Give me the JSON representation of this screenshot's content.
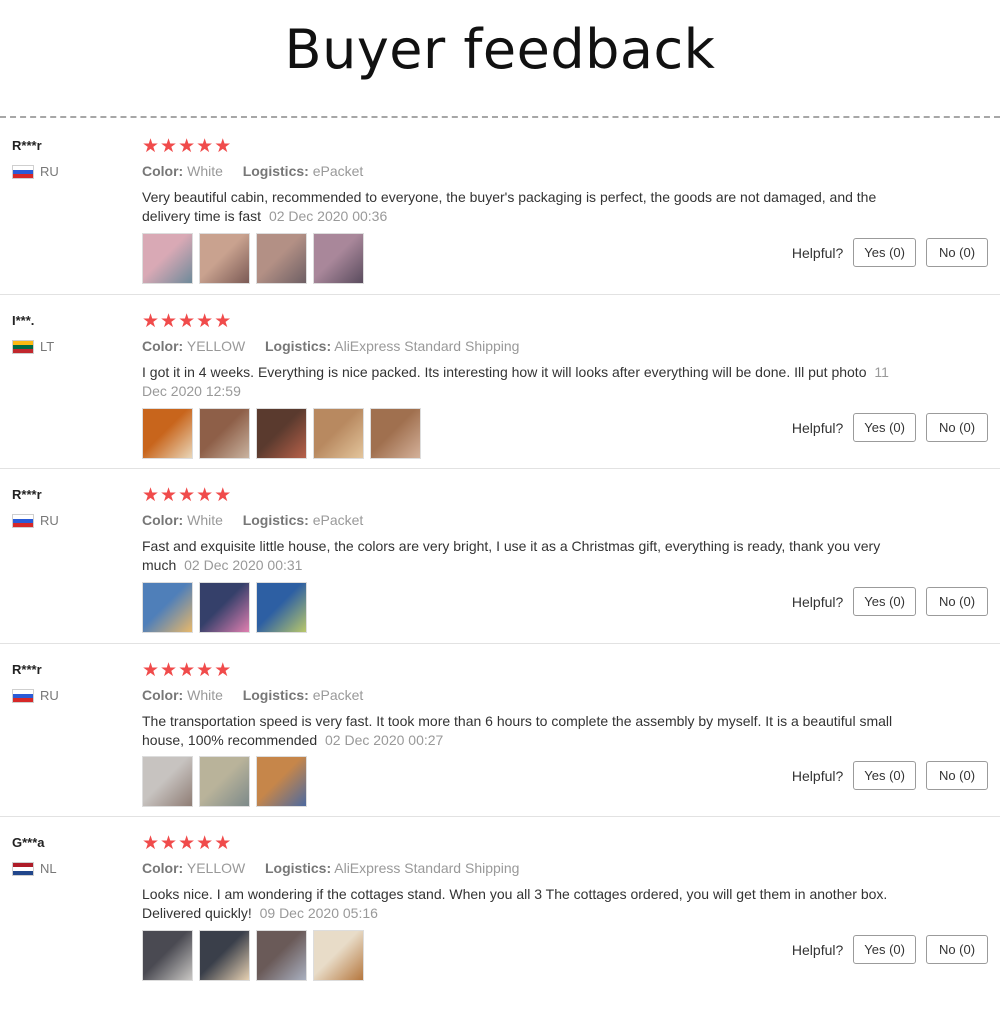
{
  "page": {
    "title": "Buyer feedback"
  },
  "labels": {
    "color": "Color:",
    "logistics": "Logistics:",
    "helpful": "Helpful?"
  },
  "reviews": [
    {
      "name": "R***r",
      "country": "RU",
      "flag": [
        "#ffffff",
        "#2a5bd7",
        "#d62828"
      ],
      "stars": 5,
      "color": "White",
      "logistics": "ePacket",
      "text": "Very beautiful cabin, recommended to everyone, the buyer's packaging is perfect, the goods are not damaged, and the delivery time is fast",
      "date": "02 Dec 2020 00:36",
      "yes": "Yes (0)",
      "no": "No (0)",
      "photos": [
        [
          "#d9a9b5",
          "#6e8a9a"
        ],
        [
          "#c9a28f",
          "#7b5a55"
        ],
        [
          "#b39085",
          "#6e5f64"
        ],
        [
          "#a9879a",
          "#5a4c5e"
        ]
      ]
    },
    {
      "name": "I***.",
      "country": "LT",
      "flag": [
        "#fdb913",
        "#006a44",
        "#c1272d"
      ],
      "stars": 5,
      "color": "YELLOW",
      "logistics": "AliExpress Standard Shipping",
      "text": "I got it in 4 weeks. Everything is nice packed. Its interesting how it will looks after everything will be done. Ill put photo",
      "date": "11 Dec 2020 12:59",
      "yes": "Yes (0)",
      "no": "No (0)",
      "photos": [
        [
          "#c8651c",
          "#e9d6b8"
        ],
        [
          "#8e5f48",
          "#c9b3a0"
        ],
        [
          "#5a3a2e",
          "#b8614a"
        ],
        [
          "#b88960",
          "#e3c59c"
        ],
        [
          "#a0704f",
          "#d4b19a"
        ]
      ]
    },
    {
      "name": "R***r",
      "country": "RU",
      "flag": [
        "#ffffff",
        "#2a5bd7",
        "#d62828"
      ],
      "stars": 5,
      "color": "White",
      "logistics": "ePacket",
      "text": "Fast and exquisite little house, the colors are very bright, I use it as a Christmas gift, everything is ready, thank you very much",
      "date": "02 Dec 2020 00:31",
      "yes": "Yes (0)",
      "no": "No (0)",
      "photos": [
        [
          "#4f7fb9",
          "#e8b86a"
        ],
        [
          "#35406a",
          "#e07fb0"
        ],
        [
          "#2d5fa3",
          "#b9c86a"
        ]
      ]
    },
    {
      "name": "R***r",
      "country": "RU",
      "flag": [
        "#ffffff",
        "#2a5bd7",
        "#d62828"
      ],
      "stars": 5,
      "color": "White",
      "logistics": "ePacket",
      "text": "The transportation speed is very fast. It took more than 6 hours to complete the assembly by myself. It is a beautiful small house, 100% recommended",
      "date": "02 Dec 2020 00:27",
      "yes": "Yes (0)",
      "no": "No (0)",
      "photos": [
        [
          "#c7c3c0",
          "#8f7d75"
        ],
        [
          "#b9b39a",
          "#7d8a8a"
        ],
        [
          "#c6864a",
          "#4d6aa0"
        ]
      ]
    },
    {
      "name": "G***a",
      "country": "NL",
      "flag": [
        "#ae1c28",
        "#ffffff",
        "#21468b"
      ],
      "stars": 5,
      "color": "YELLOW",
      "logistics": "AliExpress Standard Shipping",
      "text": "Looks nice. I am wondering if the cottages stand. When you all 3 The cottages ordered, you will get them in another box. Delivered quickly!",
      "date": "09 Dec 2020 05:16",
      "yes": "Yes (0)",
      "no": "No (0)",
      "photos": [
        [
          "#4a4a52",
          "#c9c7c4"
        ],
        [
          "#3a3f4a",
          "#e6d0b2"
        ],
        [
          "#6a5a58",
          "#a9b0c0"
        ],
        [
          "#e8dcc8",
          "#b5773e"
        ]
      ]
    }
  ]
}
